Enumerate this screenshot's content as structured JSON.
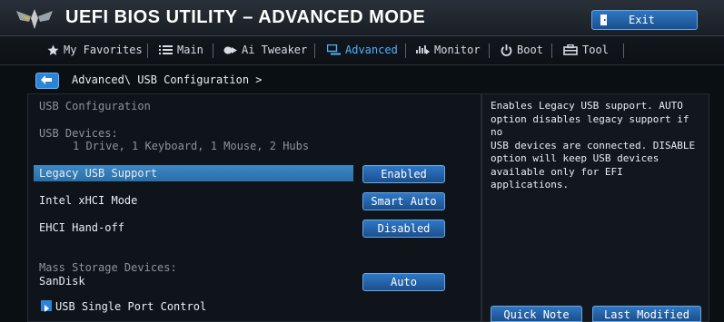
{
  "header": {
    "title": "UEFI BIOS UTILITY – ADVANCED MODE",
    "exit_label": "Exit",
    "exit_icon": "exit-door-icon",
    "logo_icon": "tuf-wings-logo"
  },
  "nav": {
    "tabs": [
      {
        "label": "My Favorites",
        "icon": "star-icon",
        "active": false
      },
      {
        "label": "Main",
        "icon": "list-icon",
        "active": false
      },
      {
        "label": "Ai Tweaker",
        "icon": "tweak-icon",
        "active": false
      },
      {
        "label": "Advanced",
        "icon": "advanced-icon",
        "active": true
      },
      {
        "label": "Monitor",
        "icon": "monitor-icon",
        "active": false
      },
      {
        "label": "Boot",
        "icon": "power-icon",
        "active": false
      },
      {
        "label": "Tool",
        "icon": "tool-icon",
        "active": false
      }
    ]
  },
  "breadcrumb": {
    "text": "Advanced\\ USB Configuration >",
    "back_icon": "back-arrow-icon"
  },
  "settings": {
    "section_title": "USB Configuration",
    "usb_devices_label": "USB Devices:",
    "usb_devices_value": "1 Drive, 1 Keyboard, 1 Mouse, 2 Hubs",
    "legacy_usb": {
      "label": "Legacy USB Support",
      "value": "Enabled"
    },
    "xhci_mode": {
      "label": "Intel xHCI Mode",
      "value": "Smart Auto"
    },
    "ehci_handoff": {
      "label": "EHCI Hand-off",
      "value": "Disabled"
    },
    "mass_storage_label": "Mass Storage Devices:",
    "sandisk": {
      "label": "SanDisk",
      "value": "Auto"
    },
    "single_port": {
      "label": "USB Single Port Control"
    }
  },
  "help": {
    "text": "Enables Legacy USB support. AUTO\noption disables legacy support if no\nUSB devices are connected. DISABLE\noption will keep USB devices\navailable only for EFI applications."
  },
  "footer": {
    "quick_note": "Quick Note",
    "last_modified": "Last Modified"
  },
  "colors": {
    "accent": "#2b84d8",
    "active_tab": "#4fb3ff",
    "highlight_row": "#3c88c4",
    "background": "#0a0f14"
  }
}
